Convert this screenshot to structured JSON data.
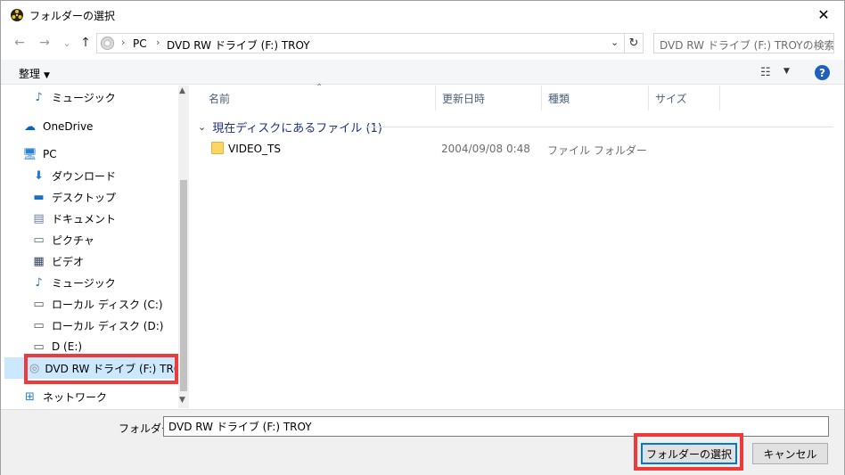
{
  "window": {
    "title": "フォルダーの選択",
    "close_glyph": "✕"
  },
  "nav": {
    "back_glyph": "←",
    "forward_glyph": "→",
    "recent_glyph": "⌄",
    "up_glyph": "↑"
  },
  "address": {
    "crumbs": [
      "PC",
      "DVD RW ドライブ (F:) TROY"
    ],
    "separator": "›",
    "dropdown_glyph": "⌄",
    "refresh_glyph": "↻"
  },
  "search": {
    "placeholder": "DVD RW ドライブ (F:) TROYの検索"
  },
  "toolbar": {
    "organize_label": "整理",
    "caret": "▼",
    "view_glyph": "☷",
    "help_glyph": "?"
  },
  "sidebar": {
    "items": [
      {
        "label": "ミュージック",
        "icon": "music-icon",
        "glyph": "♪"
      },
      {
        "label": "OneDrive",
        "icon": "cloud-icon",
        "glyph": "☁"
      },
      {
        "label": "PC",
        "icon": "computer-icon",
        "glyph": "🖥"
      },
      {
        "label": "ダウンロード",
        "icon": "download-icon",
        "glyph": "⬇"
      },
      {
        "label": "デスクトップ",
        "icon": "desktop-icon",
        "glyph": "▬"
      },
      {
        "label": "ドキュメント",
        "icon": "document-icon",
        "glyph": "▤"
      },
      {
        "label": "ピクチャ",
        "icon": "picture-icon",
        "glyph": "▭"
      },
      {
        "label": "ビデオ",
        "icon": "video-icon",
        "glyph": "▦"
      },
      {
        "label": "ミュージック",
        "icon": "music-icon",
        "glyph": "♪"
      },
      {
        "label": "ローカル ディスク (C:)",
        "icon": "drive-windows-icon",
        "glyph": "▭"
      },
      {
        "label": "ローカル ディスク (D:)",
        "icon": "drive-icon",
        "glyph": "▭"
      },
      {
        "label": "D (E:)",
        "icon": "drive-icon",
        "glyph": "▭"
      },
      {
        "label": "DVD RW ドライブ (F:) TROY",
        "icon": "dvd-icon",
        "glyph": "◎"
      },
      {
        "label": "ネットワーク",
        "icon": "network-icon",
        "glyph": "⊞"
      }
    ],
    "scroll_up_glyph": "▲",
    "scroll_down_glyph": "▼"
  },
  "columns": {
    "name": "名前",
    "modified": "更新日時",
    "type": "種類",
    "size": "サイズ",
    "sort_glyph": "⌃"
  },
  "group": {
    "label": "現在ディスクにあるファイル (1)",
    "chevron": "⌄"
  },
  "files": [
    {
      "name": "VIDEO_TS",
      "modified": "2004/09/08 0:48",
      "type": "ファイル フォルダー",
      "size": ""
    }
  ],
  "footer": {
    "folder_label": "フォルダー:",
    "folder_value": "DVD RW ドライブ (F:) TROY",
    "select_button": "フォルダーの選択",
    "cancel_button": "キャンセル"
  },
  "colors": {
    "highlight": "#ef3a3a",
    "accent": "#0078d7",
    "selected_bg": "#cce8ff",
    "group_text": "#1e3287"
  }
}
